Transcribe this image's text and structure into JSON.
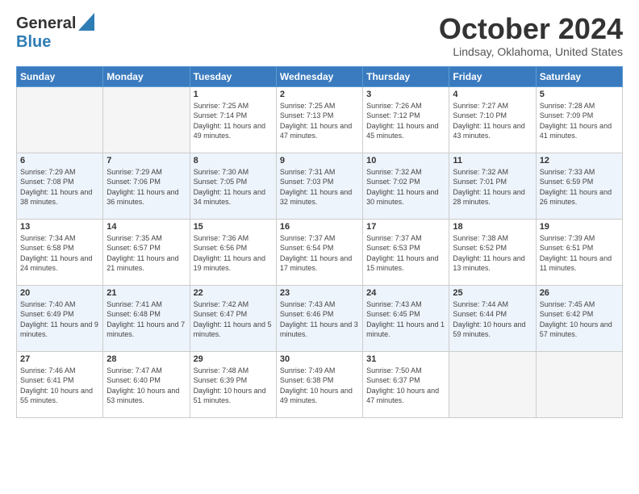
{
  "header": {
    "logo_line1": "General",
    "logo_line2": "Blue",
    "month": "October 2024",
    "location": "Lindsay, Oklahoma, United States"
  },
  "days_of_week": [
    "Sunday",
    "Monday",
    "Tuesday",
    "Wednesday",
    "Thursday",
    "Friday",
    "Saturday"
  ],
  "weeks": [
    [
      {
        "day": "",
        "info": ""
      },
      {
        "day": "",
        "info": ""
      },
      {
        "day": "1",
        "info": "Sunrise: 7:25 AM\nSunset: 7:14 PM\nDaylight: 11 hours and 49 minutes."
      },
      {
        "day": "2",
        "info": "Sunrise: 7:25 AM\nSunset: 7:13 PM\nDaylight: 11 hours and 47 minutes."
      },
      {
        "day": "3",
        "info": "Sunrise: 7:26 AM\nSunset: 7:12 PM\nDaylight: 11 hours and 45 minutes."
      },
      {
        "day": "4",
        "info": "Sunrise: 7:27 AM\nSunset: 7:10 PM\nDaylight: 11 hours and 43 minutes."
      },
      {
        "day": "5",
        "info": "Sunrise: 7:28 AM\nSunset: 7:09 PM\nDaylight: 11 hours and 41 minutes."
      }
    ],
    [
      {
        "day": "6",
        "info": "Sunrise: 7:29 AM\nSunset: 7:08 PM\nDaylight: 11 hours and 38 minutes."
      },
      {
        "day": "7",
        "info": "Sunrise: 7:29 AM\nSunset: 7:06 PM\nDaylight: 11 hours and 36 minutes."
      },
      {
        "day": "8",
        "info": "Sunrise: 7:30 AM\nSunset: 7:05 PM\nDaylight: 11 hours and 34 minutes."
      },
      {
        "day": "9",
        "info": "Sunrise: 7:31 AM\nSunset: 7:03 PM\nDaylight: 11 hours and 32 minutes."
      },
      {
        "day": "10",
        "info": "Sunrise: 7:32 AM\nSunset: 7:02 PM\nDaylight: 11 hours and 30 minutes."
      },
      {
        "day": "11",
        "info": "Sunrise: 7:32 AM\nSunset: 7:01 PM\nDaylight: 11 hours and 28 minutes."
      },
      {
        "day": "12",
        "info": "Sunrise: 7:33 AM\nSunset: 6:59 PM\nDaylight: 11 hours and 26 minutes."
      }
    ],
    [
      {
        "day": "13",
        "info": "Sunrise: 7:34 AM\nSunset: 6:58 PM\nDaylight: 11 hours and 24 minutes."
      },
      {
        "day": "14",
        "info": "Sunrise: 7:35 AM\nSunset: 6:57 PM\nDaylight: 11 hours and 21 minutes."
      },
      {
        "day": "15",
        "info": "Sunrise: 7:36 AM\nSunset: 6:56 PM\nDaylight: 11 hours and 19 minutes."
      },
      {
        "day": "16",
        "info": "Sunrise: 7:37 AM\nSunset: 6:54 PM\nDaylight: 11 hours and 17 minutes."
      },
      {
        "day": "17",
        "info": "Sunrise: 7:37 AM\nSunset: 6:53 PM\nDaylight: 11 hours and 15 minutes."
      },
      {
        "day": "18",
        "info": "Sunrise: 7:38 AM\nSunset: 6:52 PM\nDaylight: 11 hours and 13 minutes."
      },
      {
        "day": "19",
        "info": "Sunrise: 7:39 AM\nSunset: 6:51 PM\nDaylight: 11 hours and 11 minutes."
      }
    ],
    [
      {
        "day": "20",
        "info": "Sunrise: 7:40 AM\nSunset: 6:49 PM\nDaylight: 11 hours and 9 minutes."
      },
      {
        "day": "21",
        "info": "Sunrise: 7:41 AM\nSunset: 6:48 PM\nDaylight: 11 hours and 7 minutes."
      },
      {
        "day": "22",
        "info": "Sunrise: 7:42 AM\nSunset: 6:47 PM\nDaylight: 11 hours and 5 minutes."
      },
      {
        "day": "23",
        "info": "Sunrise: 7:43 AM\nSunset: 6:46 PM\nDaylight: 11 hours and 3 minutes."
      },
      {
        "day": "24",
        "info": "Sunrise: 7:43 AM\nSunset: 6:45 PM\nDaylight: 11 hours and 1 minute."
      },
      {
        "day": "25",
        "info": "Sunrise: 7:44 AM\nSunset: 6:44 PM\nDaylight: 10 hours and 59 minutes."
      },
      {
        "day": "26",
        "info": "Sunrise: 7:45 AM\nSunset: 6:42 PM\nDaylight: 10 hours and 57 minutes."
      }
    ],
    [
      {
        "day": "27",
        "info": "Sunrise: 7:46 AM\nSunset: 6:41 PM\nDaylight: 10 hours and 55 minutes."
      },
      {
        "day": "28",
        "info": "Sunrise: 7:47 AM\nSunset: 6:40 PM\nDaylight: 10 hours and 53 minutes."
      },
      {
        "day": "29",
        "info": "Sunrise: 7:48 AM\nSunset: 6:39 PM\nDaylight: 10 hours and 51 minutes."
      },
      {
        "day": "30",
        "info": "Sunrise: 7:49 AM\nSunset: 6:38 PM\nDaylight: 10 hours and 49 minutes."
      },
      {
        "day": "31",
        "info": "Sunrise: 7:50 AM\nSunset: 6:37 PM\nDaylight: 10 hours and 47 minutes."
      },
      {
        "day": "",
        "info": ""
      },
      {
        "day": "",
        "info": ""
      }
    ]
  ]
}
